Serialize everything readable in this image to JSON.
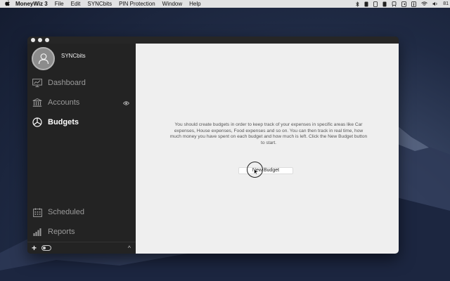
{
  "menubar": {
    "apple": "",
    "items": [
      "MoneyWiz 3",
      "File",
      "Edit",
      "SYNCbits",
      "PIN Protection",
      "Window",
      "Help"
    ],
    "battery": "81"
  },
  "sidebar": {
    "profile_name": "SYNCbits",
    "items": [
      {
        "label": "Dashboard",
        "icon": "dashboard-icon",
        "active": false
      },
      {
        "label": "Accounts",
        "icon": "bank-icon",
        "active": false
      },
      {
        "label": "Budgets",
        "icon": "pie-chart-icon",
        "active": true
      },
      {
        "label": "Scheduled",
        "icon": "calendar-icon",
        "active": false
      },
      {
        "label": "Reports",
        "icon": "bar-chart-icon",
        "active": false
      }
    ],
    "footer": {
      "add": "+",
      "collapse": "^"
    }
  },
  "main": {
    "message": "You should create budgets in order to keep track of your expenses in specific areas like Car expenses, House expenses, Food expenses and so on. You can then track in real time, how much money you have spent on each budget and how much is left. Click the New Budget button to start.",
    "new_budget_label": "New Budget"
  },
  "colors": {
    "sidebar_bg": "#232323",
    "main_bg": "#efefef",
    "active_text": "#ffffff",
    "inactive_text": "#9a9a9a"
  }
}
